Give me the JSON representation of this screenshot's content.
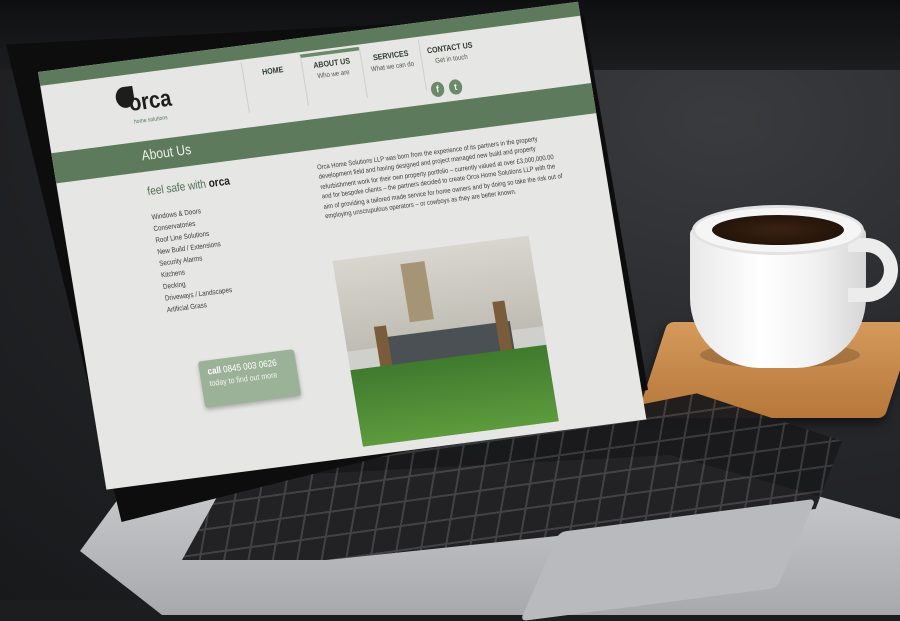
{
  "site": {
    "logo": {
      "word": "orca",
      "sub": "home solutions"
    },
    "nav": [
      {
        "label": "HOME",
        "sub": ""
      },
      {
        "label": "ABOUT US",
        "sub": "Who we are"
      },
      {
        "label": "SERVICES",
        "sub": "What we can do"
      },
      {
        "label": "CONTACT US",
        "sub": "Get in touch"
      }
    ],
    "social": {
      "facebook": "f",
      "twitter": "t"
    },
    "page_title": "About Us",
    "sidebar": {
      "tagline_lead": "feel safe with",
      "tagline_brand": "orca",
      "services": [
        "Windows & Doors",
        "Conservatories",
        "Roof Line Solutions",
        "New Build / Extensions",
        "Security Alarms",
        "Kitchens",
        "Decking",
        "Driveways / Landscapes",
        "Artificial Grass"
      ],
      "cta_call": "call",
      "cta_phone": "0845 003 0626",
      "cta_line2": "today to find out more"
    },
    "content": {
      "paragraph": "Orca Home Solutions LLP was born from the experience of its partners in the property development field and having designed and project managed new build and property refurbishment work for their own property portfolio – currently valued at over £3,000,000.00 and for bespoke clients – the partners decided to create Orca Home Solutions LLP with the aim of providing a tailored made service for home owners and by doing so take the risk out of employing unscrupulous operators – or cowboys as they are better known."
    }
  },
  "colors": {
    "brand_green": "#5d7a5c",
    "light_green": "#9bb299",
    "screen_bg": "#e6e6e4"
  }
}
